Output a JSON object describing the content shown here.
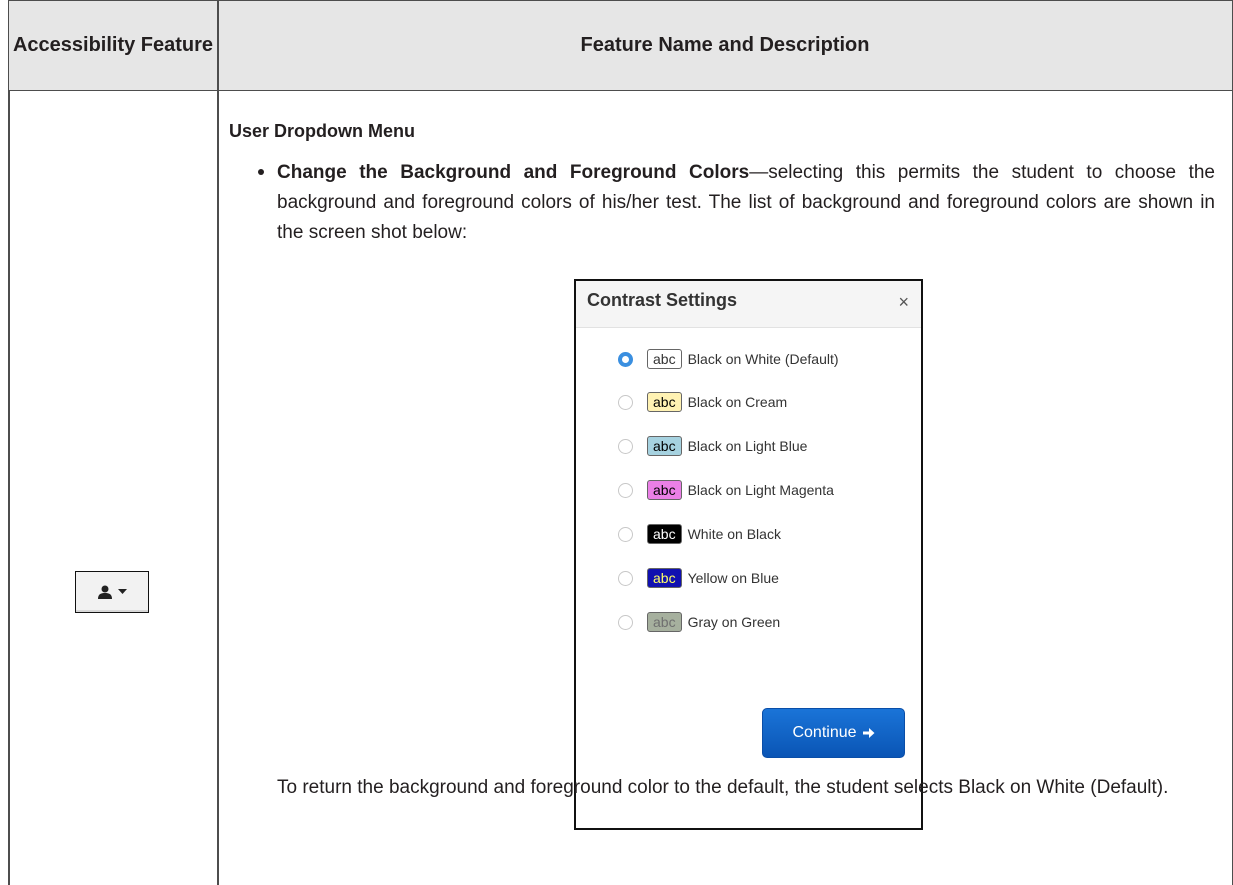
{
  "table": {
    "header": {
      "col1": "Accessibility Feature",
      "col2": "Feature Name and Description"
    },
    "row": {
      "feature_icon": "user-dropdown-icon",
      "section_title": "User Dropdown Menu",
      "bullet_bold": "Change the Background and Foreground Colors",
      "bullet_text": "—selecting this permits the student to choose the background and foreground colors of his/her test. The list of background and foreground colors are shown in the screen shot below:",
      "after_text": "To return the background and foreground color to the default, the student selects Black on White (Default)."
    }
  },
  "dialog": {
    "title": "Contrast Settings",
    "close_label": "×",
    "options": [
      {
        "swatch": "abc",
        "label": "Black on White (Default)",
        "bg": "#ffffff",
        "fg": "#333333",
        "selected": true
      },
      {
        "swatch": "abc",
        "label": "Black on Cream",
        "bg": "#fff2b3",
        "fg": "#000000",
        "selected": false
      },
      {
        "swatch": "abc",
        "label": "Black on Light Blue",
        "bg": "#a6d2e0",
        "fg": "#000000",
        "selected": false
      },
      {
        "swatch": "abc",
        "label": "Black on Light Magenta",
        "bg": "#ea7fe6",
        "fg": "#000000",
        "selected": false
      },
      {
        "swatch": "abc",
        "label": "White on Black",
        "bg": "#000000",
        "fg": "#ffffff",
        "selected": false
      },
      {
        "swatch": "abc",
        "label": "Yellow on Blue",
        "bg": "#1010b0",
        "fg": "#ffff66",
        "selected": false
      },
      {
        "swatch": "abc",
        "label": "Gray on Green",
        "bg": "#a6b09e",
        "fg": "#6f6f6f",
        "selected": false
      }
    ],
    "continue_label": "Continue",
    "continue_icon": "arrow-right-icon"
  },
  "colors": {
    "accent": "#3a8fe0",
    "button": "#0a55b5",
    "header_bg": "#e6e6e6"
  }
}
